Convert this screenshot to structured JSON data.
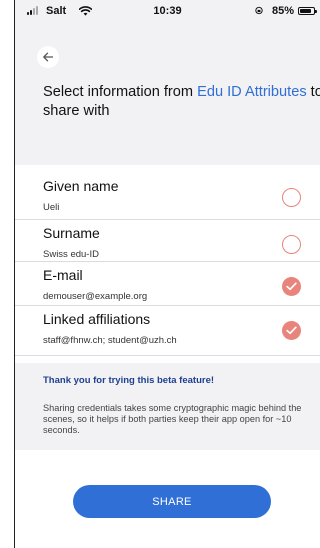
{
  "status_bar": {
    "carrier": "Salt",
    "time": "10:39",
    "battery": "85%",
    "battery_level": 0.85
  },
  "header": {
    "back_icon": "arrow-left-icon",
    "prompt_prefix": "Select information from ",
    "prompt_link": "Edu ID Attributes",
    "prompt_suffix": " to share with"
  },
  "attributes": [
    {
      "label": "Given name",
      "value": "Ueli",
      "selected": false
    },
    {
      "label": "Surname",
      "value": "Swiss edu-ID",
      "selected": false
    },
    {
      "label": "E-mail",
      "value": "demouser@example.org",
      "selected": true
    },
    {
      "label": "Linked affiliations",
      "value": "staff@fhnw.ch; student@uzh.ch",
      "selected": true
    }
  ],
  "info": {
    "title": "Thank you for trying this beta feature!",
    "body": "Sharing credentials takes some cryptographic magic behind the scenes, so it helps if both parties keep their app open for ~10 seconds."
  },
  "share_button": {
    "label": "SHARE"
  },
  "colors": {
    "accent_blue": "#2f6fd6",
    "radio_coral": "#e8847c",
    "info_title": "#1e3f8f",
    "panel_bg": "#f2f2f4"
  }
}
